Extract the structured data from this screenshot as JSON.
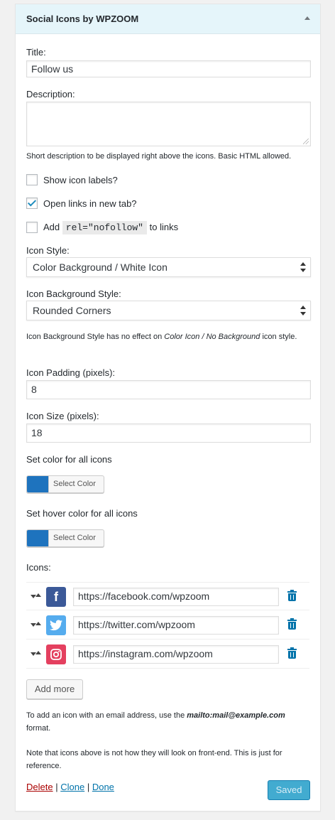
{
  "widget": {
    "title": "Social Icons by WPZOOM",
    "toggle_icon": "arrow-up-icon"
  },
  "fields": {
    "title_label": "Title:",
    "title_value": "Follow us",
    "description_label": "Description:",
    "description_value": "",
    "description_help": "Short description to be displayed right above the icons. Basic HTML allowed.",
    "show_labels": {
      "label": "Show icon labels?",
      "checked": false
    },
    "new_tab": {
      "label": "Open links in new tab?",
      "checked": true
    },
    "nofollow": {
      "label_before": "Add",
      "code": "rel=\"nofollow\"",
      "label_after": "to links",
      "checked": false
    },
    "icon_style_label": "Icon Style:",
    "icon_style_value": "Color Background / White Icon",
    "bg_style_label": "Icon Background Style:",
    "bg_style_value": "Rounded Corners",
    "bg_style_note_before": "Icon Background Style has no effect on ",
    "bg_style_note_em": "Color Icon / No Background",
    "bg_style_note_after": " icon style.",
    "padding_label": "Icon Padding (pixels):",
    "padding_value": "8",
    "size_label": "Icon Size (pixels):",
    "size_value": "18",
    "color_label": "Set color for all icons",
    "color_button": "Select Color",
    "hover_color_label": "Set hover color for all icons",
    "hover_color_button": "Select Color",
    "accent_color": "#1e73be"
  },
  "icons": {
    "label": "Icons:",
    "items": [
      {
        "network": "facebook",
        "glyph": "f",
        "color": "#3b5998",
        "url": "https://facebook.com/wpzoom"
      },
      {
        "network": "twitter",
        "glyph": "t",
        "color": "#55acee",
        "url": "https://twitter.com/wpzoom"
      },
      {
        "network": "instagram",
        "glyph": "◎",
        "color": "#e4405f",
        "url": "https://instagram.com/wpzoom"
      }
    ],
    "add_more": "Add more"
  },
  "notes": {
    "email_before": "To add an icon with an email address, use the ",
    "email_em": "mailto:mail@example.com",
    "email_after": " format.",
    "reference": "Note that icons above is not how they will look on front-end. This is just for reference."
  },
  "footer": {
    "delete": "Delete",
    "sep1": "|",
    "clone": "Clone",
    "sep2": "|",
    "done": "Done",
    "saved": "Saved"
  }
}
